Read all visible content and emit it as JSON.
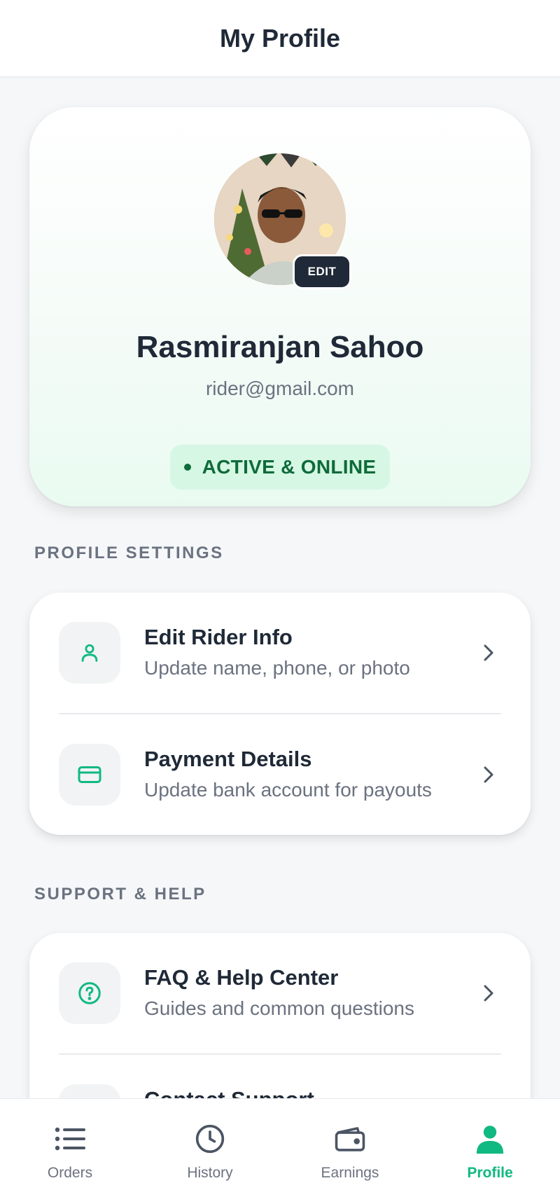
{
  "header": {
    "title": "My Profile"
  },
  "profile": {
    "edit_label": "EDIT",
    "name": "Rasmiranjan Sahoo",
    "email": "rider@gmail.com",
    "status": "ACTIVE & ONLINE"
  },
  "sections": {
    "profile_settings": {
      "title": "PROFILE SETTINGS",
      "items": [
        {
          "title": "Edit Rider Info",
          "subtitle": "Update name, phone, or photo",
          "icon": "user-icon"
        },
        {
          "title": "Payment Details",
          "subtitle": "Update bank account for payouts",
          "icon": "credit-card-icon"
        }
      ]
    },
    "support_help": {
      "title": "SUPPORT & HELP",
      "items": [
        {
          "title": "FAQ & Help Center",
          "subtitle": "Guides and common questions",
          "icon": "help-circle-icon"
        },
        {
          "title": "Contact Support",
          "subtitle": "",
          "icon": "support-icon"
        }
      ]
    }
  },
  "tabbar": {
    "items": [
      {
        "label": "Orders",
        "icon": "list-icon",
        "active": false
      },
      {
        "label": "History",
        "icon": "clock-icon",
        "active": false
      },
      {
        "label": "Earnings",
        "icon": "wallet-icon",
        "active": false
      },
      {
        "label": "Profile",
        "icon": "person-icon",
        "active": true
      }
    ]
  },
  "colors": {
    "accent": "#10b981",
    "status_bg": "#d6f7e4",
    "status_text": "#0e6b3a",
    "dark": "#1f2937",
    "muted": "#6b7280"
  }
}
